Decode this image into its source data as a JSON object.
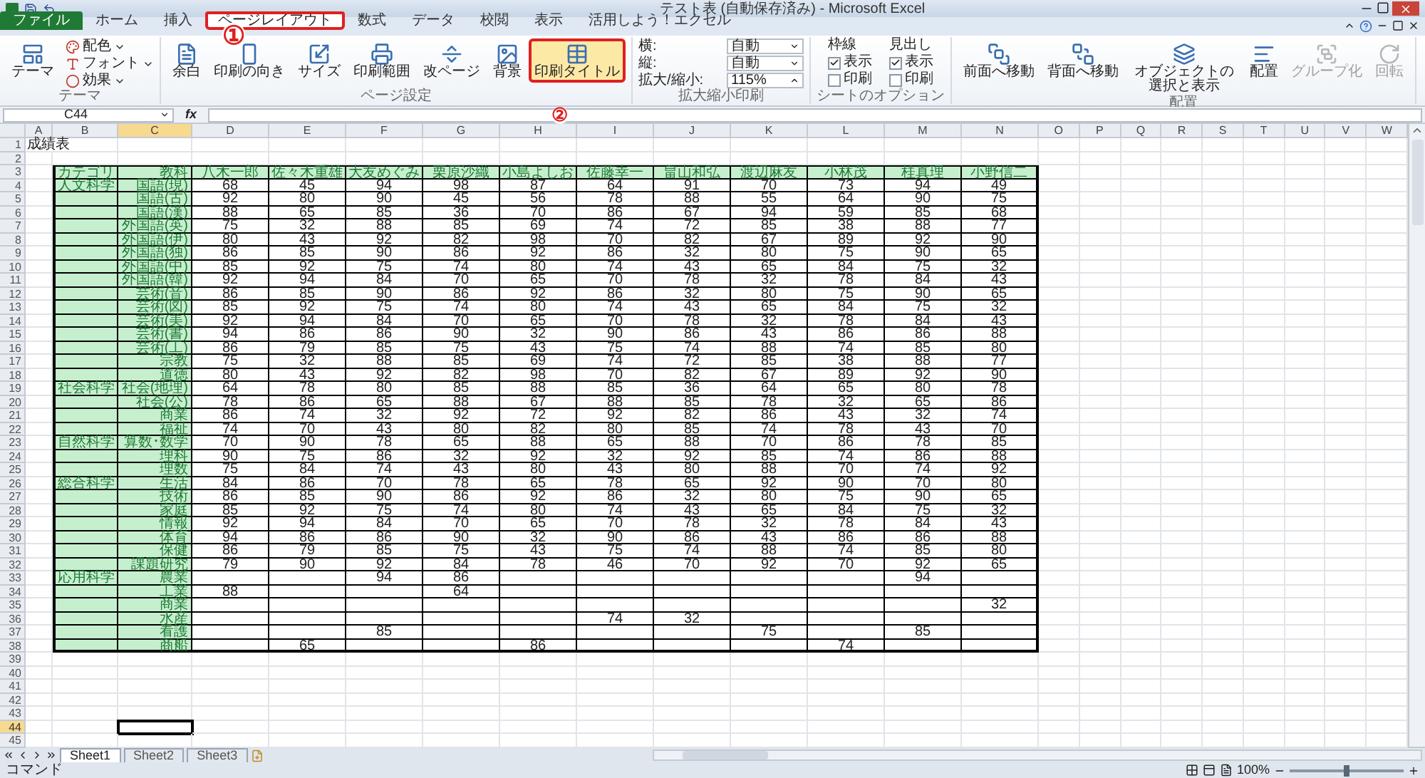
{
  "window": {
    "title": "テスト表 (自動保存済み) - Microsoft Excel"
  },
  "ribbon_tabs": [
    {
      "label": "ファイル",
      "selected": false,
      "kind": "file",
      "highlighted": false
    },
    {
      "label": "ホーム",
      "selected": false,
      "kind": "tab",
      "highlighted": false
    },
    {
      "label": "挿入",
      "selected": false,
      "kind": "tab",
      "highlighted": false
    },
    {
      "label": "ページレイアウト",
      "selected": true,
      "kind": "tab",
      "highlighted": true,
      "annotation": "①"
    },
    {
      "label": "数式",
      "selected": false,
      "kind": "tab",
      "highlighted": false
    },
    {
      "label": "データ",
      "selected": false,
      "kind": "tab",
      "highlighted": false
    },
    {
      "label": "校閲",
      "selected": false,
      "kind": "tab",
      "highlighted": false
    },
    {
      "label": "表示",
      "selected": false,
      "kind": "tab",
      "highlighted": false
    },
    {
      "label": "活用しよう！エクセル",
      "selected": false,
      "kind": "tab",
      "highlighted": false
    }
  ],
  "ribbon_groups": [
    {
      "label": "テーマ",
      "kind": "theme",
      "items": [
        {
          "kind": "large",
          "label": "テーマ",
          "disabled": false,
          "highlighted": false
        },
        {
          "kind": "small",
          "label": "配色"
        },
        {
          "kind": "small",
          "label": "フォント"
        },
        {
          "kind": "small",
          "label": "効果"
        }
      ]
    },
    {
      "label": "ページ設定",
      "kind": "buttons",
      "items": [
        {
          "kind": "large",
          "label": "余白",
          "disabled": false,
          "highlighted": false
        },
        {
          "kind": "large",
          "label": "印刷の向き",
          "disabled": false,
          "highlighted": false
        },
        {
          "kind": "large",
          "label": "サイズ",
          "disabled": false,
          "highlighted": false
        },
        {
          "kind": "large",
          "label": "印刷範囲",
          "disabled": false,
          "highlighted": false
        },
        {
          "kind": "large",
          "label": "改ページ",
          "disabled": false,
          "highlighted": false
        },
        {
          "kind": "large",
          "label": "背景",
          "disabled": false,
          "highlighted": false
        },
        {
          "kind": "large",
          "label": "印刷タイトル",
          "disabled": false,
          "highlighted": true,
          "annotation": "②"
        }
      ]
    },
    {
      "label": "拡大縮小印刷",
      "kind": "fields",
      "items": [
        {
          "kind": "dropdown",
          "label": "横:",
          "value": "自動"
        },
        {
          "kind": "dropdown",
          "label": "縦:",
          "value": "自動"
        },
        {
          "kind": "spinner",
          "label": "拡大/縮小:",
          "value": "115%"
        }
      ]
    },
    {
      "label": "シートのオプション",
      "kind": "checks",
      "items": [
        {
          "label": "枠線",
          "options": [
            {
              "label": "表示",
              "checked": true
            },
            {
              "label": "印刷",
              "checked": false
            }
          ]
        },
        {
          "label": "見出し",
          "options": [
            {
              "label": "表示",
              "checked": true
            },
            {
              "label": "印刷",
              "checked": false
            }
          ]
        }
      ]
    },
    {
      "label": "配置",
      "kind": "buttons",
      "items": [
        {
          "kind": "large",
          "label": "前面へ移動",
          "disabled": false,
          "highlighted": false
        },
        {
          "kind": "large",
          "label": "背面へ移動",
          "disabled": false,
          "highlighted": false
        },
        {
          "kind": "large",
          "label": "オブジェクトの選択と表示",
          "disabled": false,
          "highlighted": false
        },
        {
          "kind": "large",
          "label": "配置",
          "disabled": false,
          "highlighted": false
        },
        {
          "kind": "large",
          "label": "グループ化",
          "disabled": true,
          "highlighted": false
        },
        {
          "kind": "large",
          "label": "回転",
          "disabled": true,
          "highlighted": false
        }
      ]
    }
  ],
  "formula_bar": {
    "name_box": "C44",
    "function_label": "fx"
  },
  "column_headers": [
    {
      "label": "A",
      "selected": false
    },
    {
      "label": "B",
      "selected": false
    },
    {
      "label": "C",
      "selected": true
    },
    {
      "label": "D",
      "selected": false
    },
    {
      "label": "E",
      "selected": false
    },
    {
      "label": "F",
      "selected": false
    },
    {
      "label": "G",
      "selected": false
    },
    {
      "label": "H",
      "selected": false
    },
    {
      "label": "I",
      "selected": false
    },
    {
      "label": "J",
      "selected": false
    },
    {
      "label": "K",
      "selected": false
    },
    {
      "label": "L",
      "selected": false
    },
    {
      "label": "M",
      "selected": false
    },
    {
      "label": "N",
      "selected": false
    },
    {
      "label": "O",
      "selected": false
    },
    {
      "label": "P",
      "selected": false
    },
    {
      "label": "Q",
      "selected": false
    },
    {
      "label": "R",
      "selected": false
    },
    {
      "label": "S",
      "selected": false
    },
    {
      "label": "T",
      "selected": false
    },
    {
      "label": "U",
      "selected": false
    },
    {
      "label": "V",
      "selected": false
    },
    {
      "label": "W",
      "selected": false
    }
  ],
  "row_headers": [
    {
      "label": "1",
      "selected": false
    },
    {
      "label": "2",
      "selected": false
    },
    {
      "label": "3",
      "selected": false
    },
    {
      "label": "4",
      "selected": false
    },
    {
      "label": "5",
      "selected": false
    },
    {
      "label": "6",
      "selected": false
    },
    {
      "label": "7",
      "selected": false
    },
    {
      "label": "8",
      "selected": false
    },
    {
      "label": "9",
      "selected": false
    },
    {
      "label": "10",
      "selected": false
    },
    {
      "label": "11",
      "selected": false
    },
    {
      "label": "12",
      "selected": false
    },
    {
      "label": "13",
      "selected": false
    },
    {
      "label": "14",
      "selected": false
    },
    {
      "label": "15",
      "selected": false
    },
    {
      "label": "16",
      "selected": false
    },
    {
      "label": "17",
      "selected": false
    },
    {
      "label": "18",
      "selected": false
    },
    {
      "label": "19",
      "selected": false
    },
    {
      "label": "20",
      "selected": false
    },
    {
      "label": "21",
      "selected": false
    },
    {
      "label": "22",
      "selected": false
    },
    {
      "label": "23",
      "selected": false
    },
    {
      "label": "24",
      "selected": false
    },
    {
      "label": "25",
      "selected": false
    },
    {
      "label": "26",
      "selected": false
    },
    {
      "label": "27",
      "selected": false
    },
    {
      "label": "28",
      "selected": false
    },
    {
      "label": "29",
      "selected": false
    },
    {
      "label": "30",
      "selected": false
    },
    {
      "label": "31",
      "selected": false
    },
    {
      "label": "32",
      "selected": false
    },
    {
      "label": "33",
      "selected": false
    },
    {
      "label": "34",
      "selected": false
    },
    {
      "label": "35",
      "selected": false
    },
    {
      "label": "36",
      "selected": false
    },
    {
      "label": "37",
      "selected": false
    },
    {
      "label": "38",
      "selected": false
    },
    {
      "label": "39",
      "selected": false
    },
    {
      "label": "40",
      "selected": false
    },
    {
      "label": "41",
      "selected": false
    },
    {
      "label": "42",
      "selected": false
    },
    {
      "label": "43",
      "selected": false
    },
    {
      "label": "44",
      "selected": true
    },
    {
      "label": "45",
      "selected": false
    }
  ],
  "sheet_title": "成績表",
  "table": {
    "header": {
      "category": "カテゴリ",
      "subject": "教科",
      "names": [
        "八木一郎",
        "佐々木重雄",
        "大友めぐみ",
        "栗原沙織",
        "小島よしお",
        "佐藤幸一",
        "畠山和弘",
        "渡辺麻友",
        "小林茂",
        "桂真理",
        "小野信二"
      ]
    },
    "rows": [
      {
        "category": "人文科学",
        "subject": "国語(現)",
        "scores": {
          "D": "68",
          "E": "45",
          "F": "94",
          "G": "98",
          "H": "87",
          "I": "64",
          "J": "91",
          "K": "70",
          "L": "73",
          "M": "94",
          "N": "49"
        }
      },
      {
        "subject": "国語(古)",
        "scores": {
          "D": "92",
          "E": "80",
          "F": "90",
          "G": "45",
          "H": "56",
          "I": "78",
          "J": "88",
          "K": "55",
          "L": "64",
          "M": "90",
          "N": "75"
        }
      },
      {
        "subject": "国語(漢)",
        "scores": {
          "D": "88",
          "E": "65",
          "F": "85",
          "G": "36",
          "H": "70",
          "I": "86",
          "J": "67",
          "K": "94",
          "L": "59",
          "M": "85",
          "N": "68"
        }
      },
      {
        "subject": "外国語(英)",
        "scores": {
          "D": "75",
          "E": "32",
          "F": "88",
          "G": "85",
          "H": "69",
          "I": "74",
          "J": "72",
          "K": "85",
          "L": "38",
          "M": "88",
          "N": "77"
        }
      },
      {
        "subject": "外国語(伊)",
        "scores": {
          "D": "80",
          "E": "43",
          "F": "92",
          "G": "82",
          "H": "98",
          "I": "70",
          "J": "82",
          "K": "67",
          "L": "89",
          "M": "92",
          "N": "90"
        }
      },
      {
        "subject": "外国語(独)",
        "scores": {
          "D": "86",
          "E": "85",
          "F": "90",
          "G": "86",
          "H": "92",
          "I": "86",
          "J": "32",
          "K": "80",
          "L": "75",
          "M": "90",
          "N": "65"
        }
      },
      {
        "subject": "外国語(中)",
        "scores": {
          "D": "85",
          "E": "92",
          "F": "75",
          "G": "74",
          "H": "80",
          "I": "74",
          "J": "43",
          "K": "65",
          "L": "84",
          "M": "75",
          "N": "32"
        }
      },
      {
        "subject": "外国語(韓)",
        "scores": {
          "D": "92",
          "E": "94",
          "F": "84",
          "G": "70",
          "H": "65",
          "I": "70",
          "J": "78",
          "K": "32",
          "L": "78",
          "M": "84",
          "N": "43"
        }
      },
      {
        "subject": "芸術(音)",
        "scores": {
          "D": "86",
          "E": "85",
          "F": "90",
          "G": "86",
          "H": "92",
          "I": "86",
          "J": "32",
          "K": "80",
          "L": "75",
          "M": "90",
          "N": "65"
        }
      },
      {
        "subject": "芸術(図)",
        "scores": {
          "D": "85",
          "E": "92",
          "F": "75",
          "G": "74",
          "H": "80",
          "I": "74",
          "J": "43",
          "K": "65",
          "L": "84",
          "M": "75",
          "N": "32"
        }
      },
      {
        "subject": "芸術(美)",
        "scores": {
          "D": "92",
          "E": "94",
          "F": "84",
          "G": "70",
          "H": "65",
          "I": "70",
          "J": "78",
          "K": "32",
          "L": "78",
          "M": "84",
          "N": "43"
        }
      },
      {
        "subject": "芸術(書)",
        "scores": {
          "D": "94",
          "E": "86",
          "F": "86",
          "G": "90",
          "H": "32",
          "I": "90",
          "J": "86",
          "K": "43",
          "L": "86",
          "M": "86",
          "N": "88"
        }
      },
      {
        "subject": "芸術(工)",
        "scores": {
          "D": "86",
          "E": "79",
          "F": "85",
          "G": "75",
          "H": "43",
          "I": "75",
          "J": "74",
          "K": "88",
          "L": "74",
          "M": "85",
          "N": "80"
        }
      },
      {
        "subject": "宗教",
        "scores": {
          "D": "75",
          "E": "32",
          "F": "88",
          "G": "85",
          "H": "69",
          "I": "74",
          "J": "72",
          "K": "85",
          "L": "38",
          "M": "88",
          "N": "77"
        }
      },
      {
        "subject": "道徳",
        "scores": {
          "D": "80",
          "E": "43",
          "F": "92",
          "G": "82",
          "H": "98",
          "I": "70",
          "J": "82",
          "K": "67",
          "L": "89",
          "M": "92",
          "N": "90"
        }
      },
      {
        "category": "社会科学",
        "subject": "社会(地理)",
        "scores": {
          "D": "64",
          "E": "78",
          "F": "80",
          "G": "85",
          "H": "88",
          "I": "85",
          "J": "36",
          "K": "64",
          "L": "65",
          "M": "80",
          "N": "78"
        }
      },
      {
        "subject": "社会(公)",
        "scores": {
          "D": "78",
          "E": "86",
          "F": "65",
          "G": "88",
          "H": "67",
          "I": "88",
          "J": "85",
          "K": "78",
          "L": "32",
          "M": "65",
          "N": "86"
        }
      },
      {
        "subject": "商業",
        "scores": {
          "D": "86",
          "E": "74",
          "F": "32",
          "G": "92",
          "H": "72",
          "I": "92",
          "J": "82",
          "K": "86",
          "L": "43",
          "M": "32",
          "N": "74"
        }
      },
      {
        "subject": "福祉",
        "scores": {
          "D": "74",
          "E": "70",
          "F": "43",
          "G": "80",
          "H": "82",
          "I": "80",
          "J": "85",
          "K": "74",
          "L": "78",
          "M": "43",
          "N": "70"
        }
      },
      {
        "category": "自然科学",
        "subject": "算数･数学",
        "scores": {
          "D": "70",
          "E": "90",
          "F": "78",
          "G": "65",
          "H": "88",
          "I": "65",
          "J": "88",
          "K": "70",
          "L": "86",
          "M": "78",
          "N": "85"
        }
      },
      {
        "subject": "理科",
        "scores": {
          "D": "90",
          "E": "75",
          "F": "86",
          "G": "32",
          "H": "92",
          "I": "32",
          "J": "92",
          "K": "85",
          "L": "74",
          "M": "86",
          "N": "88"
        }
      },
      {
        "subject": "理数",
        "scores": {
          "D": "75",
          "E": "84",
          "F": "74",
          "G": "43",
          "H": "80",
          "I": "43",
          "J": "80",
          "K": "88",
          "L": "70",
          "M": "74",
          "N": "92"
        }
      },
      {
        "category": "総合科学",
        "subject": "生活",
        "scores": {
          "D": "84",
          "E": "86",
          "F": "70",
          "G": "78",
          "H": "65",
          "I": "78",
          "J": "65",
          "K": "92",
          "L": "90",
          "M": "70",
          "N": "80"
        }
      },
      {
        "subject": "技術",
        "scores": {
          "D": "86",
          "E": "85",
          "F": "90",
          "G": "86",
          "H": "92",
          "I": "86",
          "J": "32",
          "K": "80",
          "L": "75",
          "M": "90",
          "N": "65"
        }
      },
      {
        "subject": "家庭",
        "scores": {
          "D": "85",
          "E": "92",
          "F": "75",
          "G": "74",
          "H": "80",
          "I": "74",
          "J": "43",
          "K": "65",
          "L": "84",
          "M": "75",
          "N": "32"
        }
      },
      {
        "subject": "情報",
        "scores": {
          "D": "92",
          "E": "94",
          "F": "84",
          "G": "70",
          "H": "65",
          "I": "70",
          "J": "78",
          "K": "32",
          "L": "78",
          "M": "84",
          "N": "43"
        }
      },
      {
        "subject": "体育",
        "scores": {
          "D": "94",
          "E": "86",
          "F": "86",
          "G": "90",
          "H": "32",
          "I": "90",
          "J": "86",
          "K": "43",
          "L": "86",
          "M": "86",
          "N": "88"
        }
      },
      {
        "subject": "保健",
        "scores": {
          "D": "86",
          "E": "79",
          "F": "85",
          "G": "75",
          "H": "43",
          "I": "75",
          "J": "74",
          "K": "88",
          "L": "74",
          "M": "85",
          "N": "80"
        }
      },
      {
        "subject": "課題研究",
        "scores": {
          "D": "79",
          "E": "90",
          "F": "92",
          "G": "84",
          "H": "78",
          "I": "46",
          "J": "70",
          "K": "92",
          "L": "70",
          "M": "92",
          "N": "65"
        }
      },
      {
        "category": "応用科学",
        "subject": "農業",
        "scores": {
          "F": "94",
          "G": "86",
          "M": "94"
        }
      },
      {
        "subject": "工業",
        "scores": {
          "D": "88",
          "G": "64"
        }
      },
      {
        "subject": "商業",
        "scores": {
          "N": "32"
        }
      },
      {
        "subject": "水産",
        "scores": {
          "I": "74",
          "J": "32"
        }
      },
      {
        "subject": "看護",
        "scores": {
          "F": "85",
          "K": "75",
          "M": "85"
        }
      },
      {
        "subject": "商船",
        "scores": {
          "E": "65",
          "H": "86",
          "L": "74"
        }
      }
    ]
  },
  "sheet_tabs": [
    {
      "label": "Sheet1",
      "selected": true
    },
    {
      "label": "Sheet2",
      "selected": false
    },
    {
      "label": "Sheet3",
      "selected": false
    }
  ],
  "status_bar": {
    "mode": "コマンド",
    "zoom": "100%",
    "zoom_slider": {
      "level": 0.5
    }
  }
}
